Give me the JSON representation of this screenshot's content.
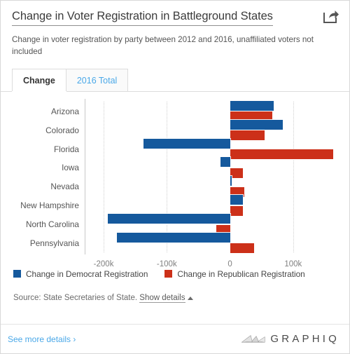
{
  "header": {
    "title": "Change in Voter Registration in Battleground States",
    "subtitle": "Change in voter registration by party between 2012 and 2016, unaffiliated voters not included",
    "share_icon": "share-icon"
  },
  "tabs": [
    {
      "label": "Change",
      "active": true
    },
    {
      "label": "2016 Total",
      "active": false
    }
  ],
  "legend": [
    {
      "label": "Change in Democrat Registration",
      "color": "#15599d"
    },
    {
      "label": "Change in Republican Registration",
      "color": "#cc3019"
    }
  ],
  "source": {
    "text": "Source: State Secretaries of State.",
    "details_link": "Show details",
    "caret": "caret-up-icon"
  },
  "footer": {
    "see_more": "See more details ›",
    "brand": "GRAPHIQ",
    "brand_mark": "graphiq-logo-icon"
  },
  "chart_data": {
    "type": "bar",
    "orientation": "horizontal",
    "title": "Change in Voter Registration in Battleground States",
    "subtitle": "Change in voter registration by party between 2012 and 2016, unaffiliated voters not included",
    "xlabel": "",
    "ylabel": "",
    "xlim": [
      -230000,
      180000
    ],
    "grid": true,
    "legend_position": "bottom",
    "xticks": [
      -200000,
      -100000,
      0,
      100000
    ],
    "xtick_labels": [
      "-200k",
      "-100k",
      "0",
      "100k"
    ],
    "categories": [
      "Arizona",
      "Colorado",
      "Florida",
      "Iowa",
      "Nevada",
      "New Hampshire",
      "North Carolina",
      "Pennsylvania"
    ],
    "series": [
      {
        "name": "Change in Democrat Registration",
        "color": "#15599d",
        "values": [
          69000,
          84000,
          -137000,
          -15000,
          3000,
          21000,
          -193000,
          -179000
        ]
      },
      {
        "name": "Change in Republican Registration",
        "color": "#cc3019",
        "values": [
          67000,
          55000,
          163000,
          20000,
          23000,
          20000,
          -22000,
          38000
        ]
      }
    ]
  }
}
